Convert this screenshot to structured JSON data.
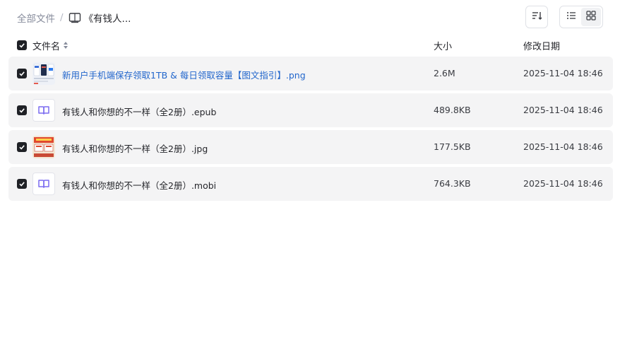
{
  "breadcrumb": {
    "root": "全部文件",
    "separator": "/",
    "current": "《有钱人..."
  },
  "table": {
    "header": {
      "name": "文件名",
      "size": "大小",
      "date": "修改日期"
    },
    "rows": [
      {
        "name": "新用户手机端保存领取1TB & 每日领取容量【图文指引】.png",
        "size": "2.6M",
        "date": "2025-11-04 18:46",
        "thumb": "image-preview-icon",
        "link": true
      },
      {
        "name": "有钱人和你想的不一样（全2册）.epub",
        "size": "489.8KB",
        "date": "2025-11-04 18:46",
        "thumb": "ebook-file-icon",
        "link": false
      },
      {
        "name": "有钱人和你想的不一样（全2册）.jpg",
        "size": "177.5KB",
        "date": "2025-11-04 18:46",
        "thumb": "book-cover-preview",
        "link": false
      },
      {
        "name": "有钱人和你想的不一样（全2册）.mobi",
        "size": "764.3KB",
        "date": "2025-11-04 18:46",
        "thumb": "ebook-file-icon",
        "link": false
      }
    ]
  },
  "colors": {
    "link": "#2266cc",
    "row_bg": "#f4f4f5",
    "checkbox": "#1f2126",
    "ebook_icon": "#7b6cf0"
  }
}
